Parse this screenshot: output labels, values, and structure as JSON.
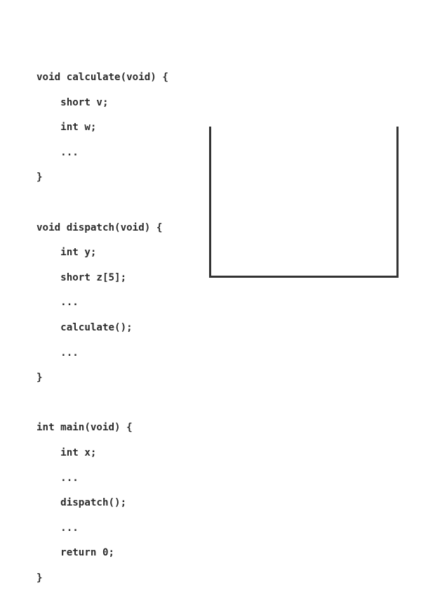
{
  "code": {
    "lines": [
      "void calculate(void) {",
      "    short v;",
      "    int w;",
      "    ...",
      "}",
      "",
      "void dispatch(void) {",
      "    int y;",
      "    short z[5];",
      "    ...",
      "    calculate();",
      "    ...",
      "}",
      "",
      "int main(void) {",
      "    int x;",
      "    ...",
      "    dispatch();",
      "    ...",
      "    return 0;",
      "}"
    ]
  },
  "stack": {
    "stroke_color": "#333333",
    "frames": []
  }
}
